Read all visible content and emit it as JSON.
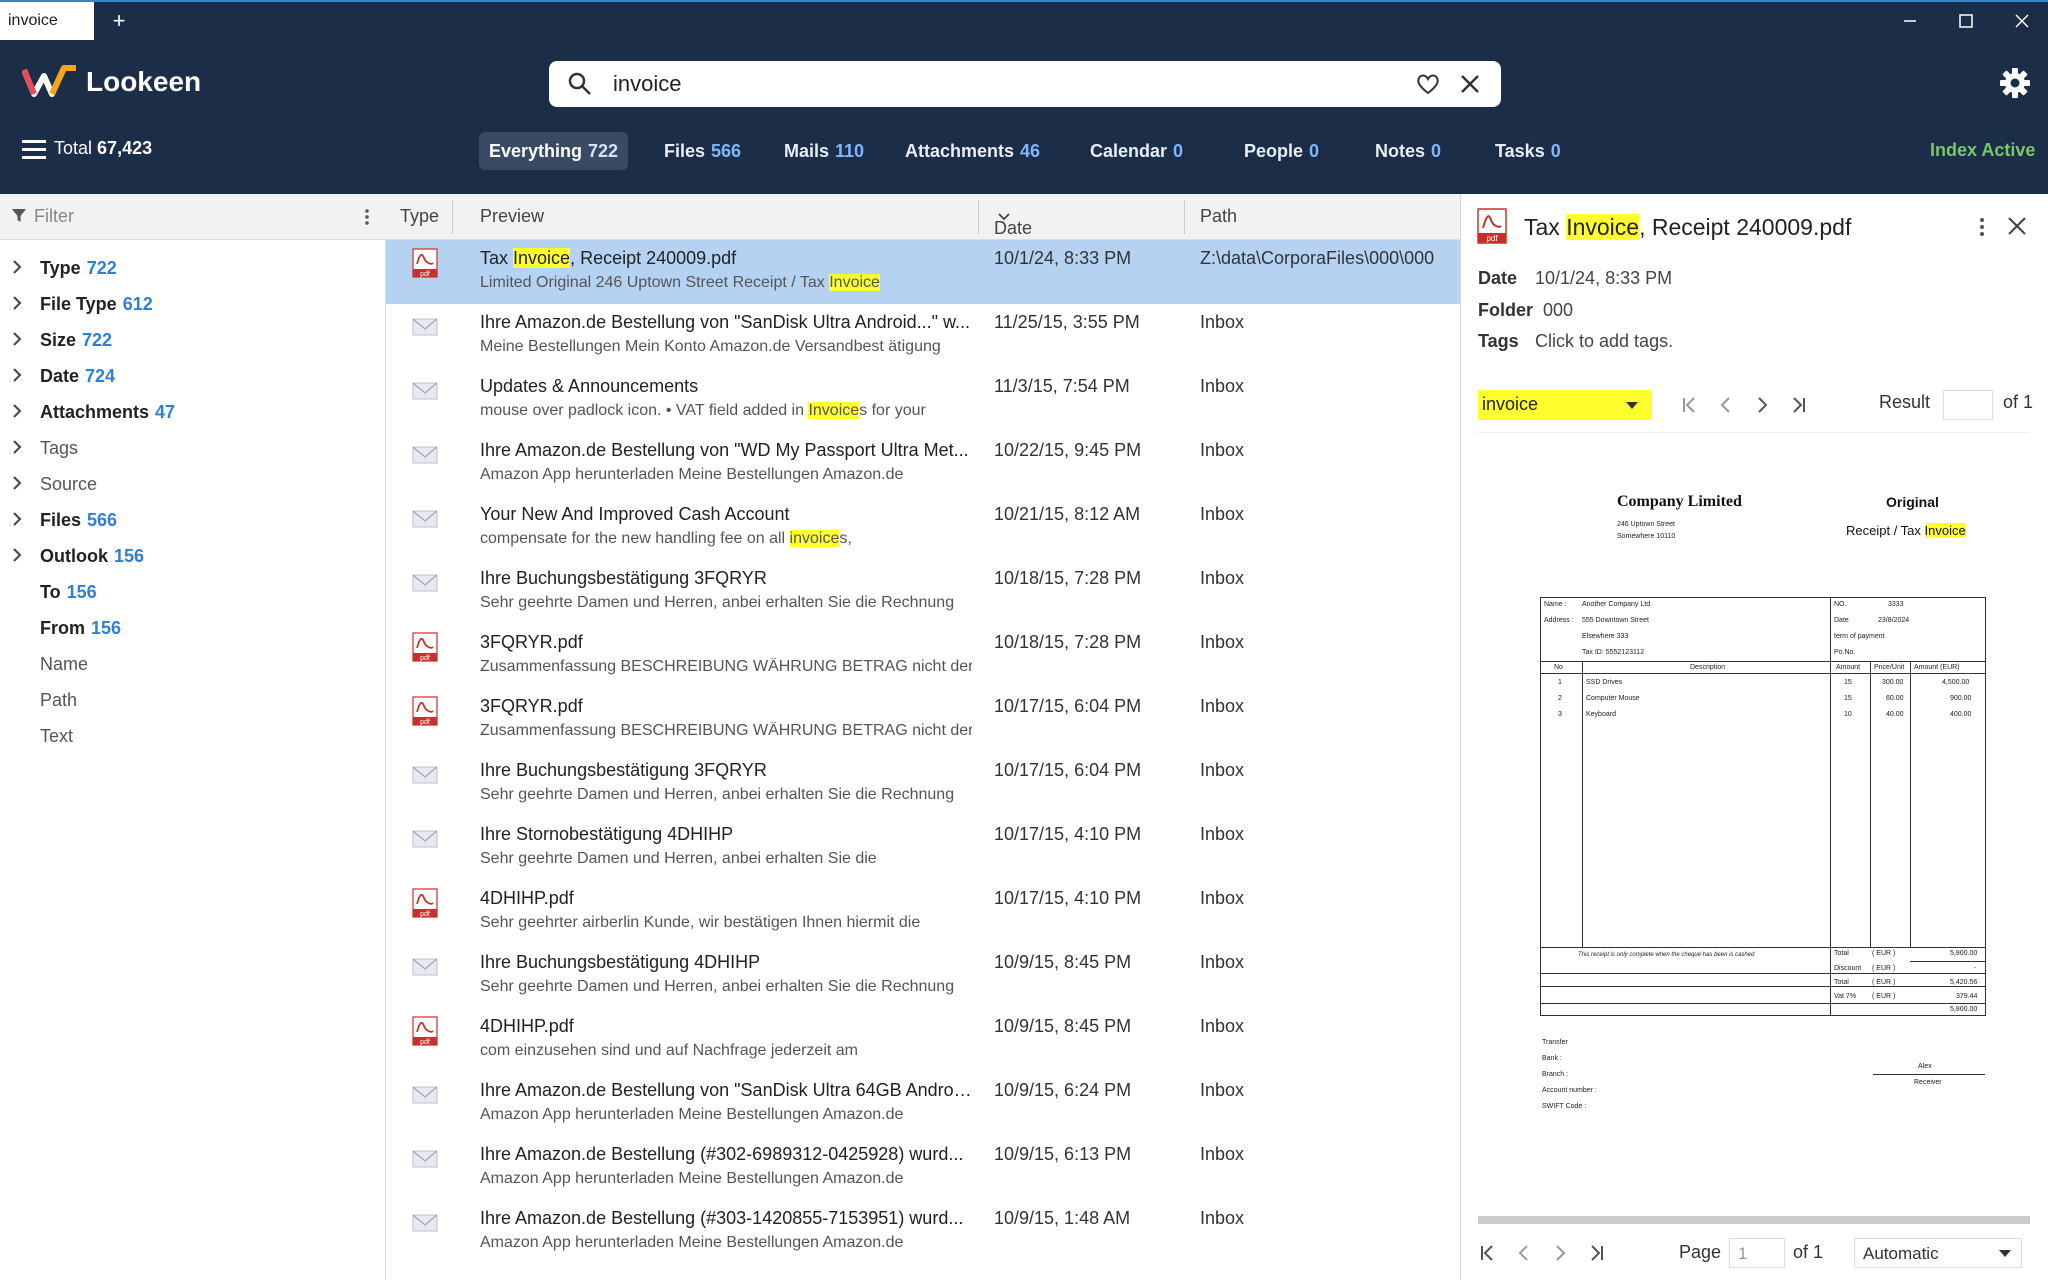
{
  "window": {
    "tab_label": "invoice",
    "new_tab": "+",
    "minimize": "—",
    "maximize": "☐",
    "close": "✕"
  },
  "header": {
    "brand": "Lookeen",
    "search_value": "invoice",
    "total_label": "Total",
    "total_count": "67,423",
    "index_status": "Index Active",
    "categories": [
      {
        "label": "Everything",
        "count": "722"
      },
      {
        "label": "Files",
        "count": "566"
      },
      {
        "label": "Mails",
        "count": "110"
      },
      {
        "label": "Attachments",
        "count": "46"
      },
      {
        "label": "Calendar",
        "count": "0"
      },
      {
        "label": "People",
        "count": "0"
      },
      {
        "label": "Notes",
        "count": "0"
      },
      {
        "label": "Tasks",
        "count": "0"
      }
    ],
    "colors": {
      "bg": "#1c2d47",
      "accent": "#2f80d1",
      "status": "#7cc56b",
      "highlight": "#ffff2e"
    }
  },
  "sidebar": {
    "filter_placeholder": "Filter",
    "facets": [
      {
        "label": "Type",
        "count": "722"
      },
      {
        "label": "File Type",
        "count": "612"
      },
      {
        "label": "Size",
        "count": "722"
      },
      {
        "label": "Date",
        "count": "724"
      },
      {
        "label": "Attachments",
        "count": "47"
      },
      {
        "label": "Tags",
        "count": ""
      },
      {
        "label": "Source",
        "count": ""
      },
      {
        "label": "Files",
        "count": "566"
      },
      {
        "label": "Outlook",
        "count": "156"
      },
      {
        "label": "To",
        "count": "156"
      },
      {
        "label": "From",
        "count": "156"
      },
      {
        "label": "Name",
        "count": ""
      },
      {
        "label": "Path",
        "count": ""
      },
      {
        "label": "Text",
        "count": ""
      }
    ]
  },
  "results": {
    "columns": {
      "type": "Type",
      "preview": "Preview",
      "date": "Date",
      "path": "Path"
    },
    "rows": [
      {
        "kind": "pdf",
        "t1": "Tax ",
        "t1h": "Invoice",
        "t1e": ", Receipt 240009.pdf",
        "s1": "Limited Original 246 Uptown Street Receipt / Tax ",
        "s1h": "Invoice",
        "s1e": "",
        "date": "10/1/24, 8:33 PM",
        "path": "Z:\\data\\CorporaFiles\\000\\000"
      },
      {
        "kind": "mail",
        "t1": "Ihre Amazon.de Bestellung von \"SanDisk Ultra Android...\" w...",
        "t1h": "",
        "t1e": "",
        "s1": "Meine Bestellungen Mein Konto Amazon.de Versandbest ätigung",
        "s1h": "",
        "s1e": "",
        "date": "11/25/15, 3:55 PM",
        "path": "Inbox"
      },
      {
        "kind": "mail",
        "t1": "Updates & Announcements",
        "t1h": "",
        "t1e": "",
        "s1": "mouse over padlock icon. • VAT field added in ",
        "s1h": "Invoice",
        "s1e": "s for your",
        "date": "11/3/15, 7:54 PM",
        "path": "Inbox"
      },
      {
        "kind": "mail",
        "t1": "Ihre Amazon.de Bestellung von \"WD My Passport Ultra Met...",
        "t1h": "",
        "t1e": "",
        "s1": "Amazon App herunterladen Meine Bestellungen Amazon.de",
        "s1h": "",
        "s1e": "",
        "date": "10/22/15, 9:45 PM",
        "path": "Inbox"
      },
      {
        "kind": "mail",
        "t1": "Your New And Improved Cash Account",
        "t1h": "",
        "t1e": "",
        "s1": "compensate for the new handling fee on all ",
        "s1h": "invoice",
        "s1e": "s,",
        "date": "10/21/15, 8:12 AM",
        "path": "Inbox"
      },
      {
        "kind": "mail",
        "t1": "Ihre Buchungsbestätigung 3FQRYR",
        "t1h": "",
        "t1e": "",
        "s1": "Sehr geehrte Damen und Herren, anbei erhalten Sie die Rechnung",
        "s1h": "",
        "s1e": "",
        "date": "10/18/15, 7:28 PM",
        "path": "Inbox"
      },
      {
        "kind": "pdf",
        "t1": "3FQRYR.pdf",
        "t1h": "",
        "t1e": "",
        "s1": "Zusammenfassung BESCHREIBUNG WÄHRUNG BETRAG nicht der",
        "s1h": "",
        "s1e": "",
        "date": "10/18/15, 7:28 PM",
        "path": "Inbox"
      },
      {
        "kind": "pdf",
        "t1": "3FQRYR.pdf",
        "t1h": "",
        "t1e": "",
        "s1": "Zusammenfassung BESCHREIBUNG WÄHRUNG BETRAG nicht der",
        "s1h": "",
        "s1e": "",
        "date": "10/17/15, 6:04 PM",
        "path": "Inbox"
      },
      {
        "kind": "mail",
        "t1": "Ihre Buchungsbestätigung 3FQRYR",
        "t1h": "",
        "t1e": "",
        "s1": "Sehr geehrte Damen und Herren, anbei erhalten Sie die Rechnung",
        "s1h": "",
        "s1e": "",
        "date": "10/17/15, 6:04 PM",
        "path": "Inbox"
      },
      {
        "kind": "mail",
        "t1": "Ihre Stornobestätigung 4DHIHP",
        "t1h": "",
        "t1e": "",
        "s1": "Sehr geehrte Damen und Herren, anbei erhalten Sie die",
        "s1h": "",
        "s1e": "",
        "date": "10/17/15, 4:10 PM",
        "path": "Inbox"
      },
      {
        "kind": "pdf",
        "t1": "4DHIHP.pdf",
        "t1h": "",
        "t1e": "",
        "s1": "Sehr geehrter airberlin Kunde, wir bestätigen Ihnen hiermit die",
        "s1h": "",
        "s1e": "",
        "date": "10/17/15, 4:10 PM",
        "path": "Inbox"
      },
      {
        "kind": "mail",
        "t1": "Ihre Buchungsbestätigung 4DHIHP",
        "t1h": "",
        "t1e": "",
        "s1": "Sehr geehrte Damen und Herren, anbei erhalten Sie die Rechnung",
        "s1h": "",
        "s1e": "",
        "date": "10/9/15, 8:45 PM",
        "path": "Inbox"
      },
      {
        "kind": "pdf",
        "t1": "4DHIHP.pdf",
        "t1h": "",
        "t1e": "",
        "s1": "com einzusehen sind und auf Nachfrage jederzeit am",
        "s1h": "",
        "s1e": "",
        "date": "10/9/15, 8:45 PM",
        "path": "Inbox"
      },
      {
        "kind": "mail",
        "t1": "Ihre Amazon.de Bestellung von \"SanDisk Ultra 64GB Androi...",
        "t1h": "",
        "t1e": "",
        "s1": "Amazon App herunterladen Meine Bestellungen Amazon.de",
        "s1h": "",
        "s1e": "",
        "date": "10/9/15, 6:24 PM",
        "path": "Inbox"
      },
      {
        "kind": "mail",
        "t1": "Ihre Amazon.de Bestellung (#302-6989312-0425928) wurd...",
        "t1h": "",
        "t1e": "",
        "s1": "Amazon App herunterladen Meine Bestellungen Amazon.de",
        "s1h": "",
        "s1e": "",
        "date": "10/9/15, 6:13 PM",
        "path": "Inbox"
      },
      {
        "kind": "mail",
        "t1": "Ihre Amazon.de Bestellung (#303-1420855-7153951) wurd...",
        "t1h": "",
        "t1e": "",
        "s1": "Amazon App herunterladen Meine Bestellungen Amazon.de",
        "s1h": "",
        "s1e": "",
        "date": "10/9/15, 1:48 AM",
        "path": "Inbox"
      }
    ]
  },
  "preview": {
    "title_pre": "Tax ",
    "title_hl": "Invoice",
    "title_post": ", Receipt 240009.pdf",
    "date_label": "Date",
    "date_value": "10/1/24, 8:33 PM",
    "folder_label": "Folder",
    "folder_value": "000",
    "tags_label": "Tags",
    "tags_value": "Click to add tags.",
    "term": "invoice",
    "result_label": "Result",
    "result_of": "of 1",
    "page_label": "Page",
    "page_value": "1",
    "page_of": "of 1",
    "zoom": "Automatic",
    "doc": {
      "company": "Company Limited",
      "addr1": "246 Uptown Street",
      "addr2": "Somewhere 10110",
      "original": "Original",
      "receipt_pre": "Receipt / Tax ",
      "receipt_hl": "Invoice",
      "name_l": "Name :",
      "name_v": "Another Company Ltd.",
      "address_l": "Address :",
      "address_v1": "555 Downtown Street",
      "address_v2": "Elsewhere 333",
      "taxid": "Tax ID: 5552123112",
      "no_l": "NO.",
      "no_v": "3333",
      "date_l": "Date",
      "date_v": "23/8/2024",
      "term_l": "term of payment",
      "po_l": "Po.No.",
      "h_no": "No",
      "h_desc": "Description",
      "h_amount": "Amount",
      "h_price": "Price/Unit",
      "h_amount_eur": "Amount (EUR)",
      "items": [
        {
          "no": "1",
          "desc": "SSD Drives",
          "qty": "15",
          "price": "300.00",
          "amt": "4,500.00"
        },
        {
          "no": "2",
          "desc": "Computer Mouse",
          "qty": "15",
          "price": "60.00",
          "amt": "900.00"
        },
        {
          "no": "3",
          "desc": "Keyboard",
          "qty": "10",
          "price": "40.00",
          "amt": "400.00"
        }
      ],
      "note": "This receipt is only complete when the cheque has been is cashed",
      "totals": [
        {
          "l": "Total",
          "u": "( EUR )",
          "v": "5,800.00"
        },
        {
          "l": "Discount",
          "u": "( EUR )",
          "v": "-"
        },
        {
          "l": "Total",
          "u": "( EUR )",
          "v": "5,420.56"
        },
        {
          "l": "Vat 7%",
          "u": "( EUR )",
          "v": "379.44"
        }
      ],
      "grand": "5,800.00",
      "transfer": "Transfer",
      "bank": "Bank :",
      "branch": "Branch :",
      "account": "Account number :",
      "swift": "SWIFT Code :",
      "sign_name": "Alex",
      "sign_role": "Receiver"
    }
  }
}
